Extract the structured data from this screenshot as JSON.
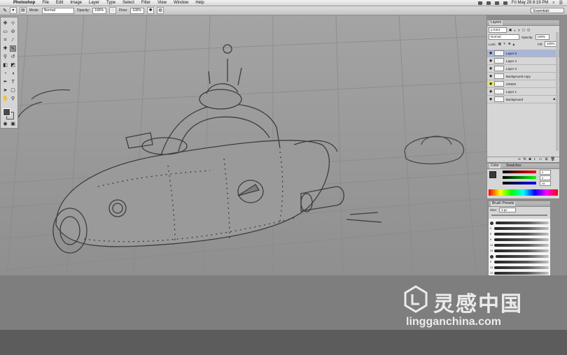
{
  "menubar": {
    "app": "Photoshop",
    "items": [
      "File",
      "Edit",
      "Image",
      "Layer",
      "Type",
      "Select",
      "Filter",
      "View",
      "Window",
      "Help"
    ],
    "clock": "Fri May 29  8:19 PM"
  },
  "options": {
    "mode_label": "Mode:",
    "mode_value": "Normal",
    "opacity_label": "Opacity:",
    "opacity_value": "100%",
    "flow_label": "Flow:",
    "flow_value": "100%",
    "workspace": "Essentials"
  },
  "layers_panel": {
    "title": "Layers",
    "kind_label": "ρ Kind",
    "blend_mode": "Normal",
    "opacity_label": "Opacity:",
    "opacity_value": "100%",
    "lock_label": "Lock:",
    "fill_label": "Fill:",
    "fill_value": "100%",
    "layers": [
      {
        "name": "Layer 5",
        "selected": true,
        "highlight": false
      },
      {
        "name": "Layer 4",
        "selected": false,
        "highlight": false
      },
      {
        "name": "Layer 3",
        "selected": false,
        "highlight": false
      },
      {
        "name": "Background copy",
        "selected": false,
        "highlight": false
      },
      {
        "name": "GRIDS",
        "selected": false,
        "highlight": true
      },
      {
        "name": "Layer 1",
        "selected": false,
        "highlight": false
      },
      {
        "name": "Background",
        "selected": false,
        "highlight": false
      }
    ]
  },
  "color_panel": {
    "tabs": [
      "Color",
      "Swatches"
    ],
    "r": "0",
    "g": "0",
    "b": "28"
  },
  "brush_presets": {
    "title": "Brush Presets",
    "size_label": "Size:",
    "size_value": "3 px",
    "numbers": [
      "3",
      "5",
      "9",
      "13",
      "19",
      "",
      "9",
      "13",
      "19",
      "17",
      "45",
      "65",
      "100"
    ]
  },
  "watermark": {
    "cn": "灵感中国",
    "url": "lingganchina.com"
  },
  "colors": {
    "canvas": "#999999",
    "layer_selected": "#a9b6d6",
    "grids_eye": "#e3e36a"
  }
}
